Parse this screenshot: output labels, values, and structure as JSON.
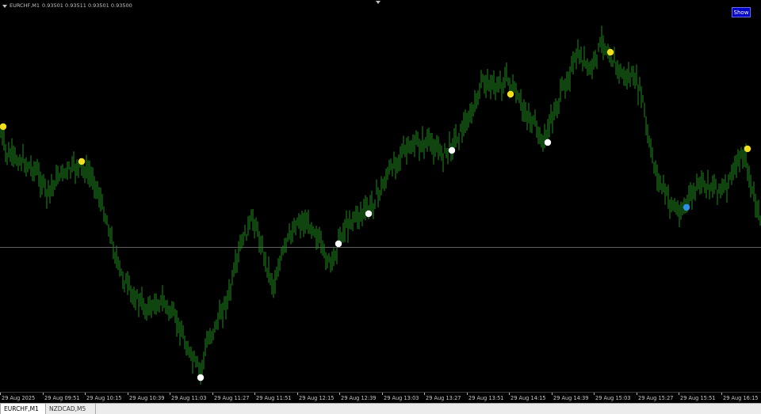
{
  "header": {
    "symbol": "EURCHF,M1",
    "quote": "0.93501 0.93511 0.93501 0.93500"
  },
  "show_button": "Show",
  "time_axis": [
    "29 Aug 2025",
    "29 Aug 09:51",
    "29 Aug 10:15",
    "29 Aug 10:39",
    "29 Aug 11:03",
    "29 Aug 11:27",
    "29 Aug 11:51",
    "29 Aug 12:15",
    "29 Aug 12:39",
    "29 Aug 13:03",
    "29 Aug 13:27",
    "29 Aug 13:51",
    "29 Aug 14:15",
    "29 Aug 14:39",
    "29 Aug 15:03",
    "29 Aug 15:27",
    "29 Aug 15:51",
    "29 Aug 16:15"
  ],
  "tabs": [
    {
      "label": "EURCHF,M1",
      "active": true
    },
    {
      "label": "NZDCAD,M5",
      "active": false
    }
  ],
  "colors": {
    "background": "#000000",
    "candle": "#1f8a1f",
    "marker_yellow": "#f0e020",
    "marker_white": "#ffffff",
    "marker_blue": "#2d8fe0",
    "level_line": "#606060"
  }
}
